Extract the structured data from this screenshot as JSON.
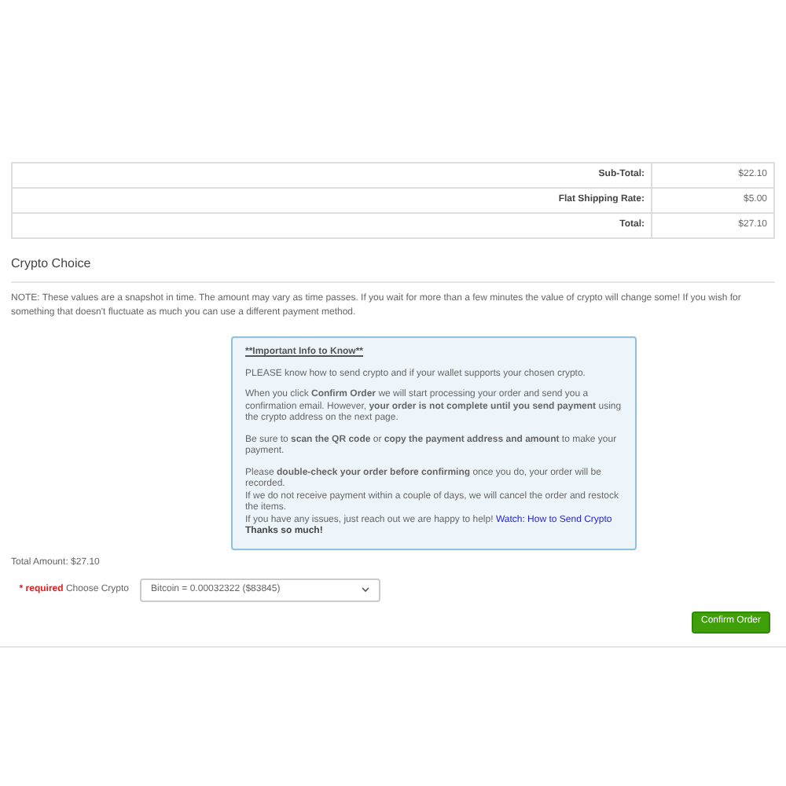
{
  "totals": [
    {
      "label": "Sub-Total:",
      "value": "$22.10"
    },
    {
      "label": "Flat Shipping Rate:",
      "value": "$5.00"
    },
    {
      "label": "Total:",
      "value": "$27.10"
    }
  ],
  "section_title": "Crypto Choice",
  "note": "NOTE: These values are a snapshot in time. The amount may vary as time passes. If you wait for more than a few minutes the value of crypto will change some! If you wish for something that doesn't fluctuate as much you can use a different payment method.",
  "info_box": {
    "title": "**Important Info to Know**",
    "paragraphs": [
      [
        {
          "text": "PLEASE know how to send crypto and if your wallet supports your chosen crypto."
        }
      ],
      [
        {
          "text": "When you click **Confirm Order** we will start processing your order and send you a confirmation email. However, **your order is not complete until you send payment** using the crypto address on the next page."
        }
      ],
      [
        {
          "text": "Be sure to **scan the QR code** or **copy the payment address and amount** to make your payment."
        }
      ],
      [
        {
          "text": "Please **double-check your order before confirming** once you do, your order will be recorded."
        },
        {
          "text": "If we do not receive payment within a couple of days, we will cancel the order and restock the items."
        },
        {
          "text": "If you have any issues, just reach out we are happy to help!",
          "link": "Watch: How to Send Crypto"
        },
        {
          "text": "Thanks so much!",
          "bold": true
        }
      ]
    ]
  },
  "total_amount": "Total Amount: $27.10",
  "crypto_field": {
    "required": "* required",
    "label": "Choose Crypto",
    "value": "Bitcoin = 0.00032322 ($83845)"
  },
  "confirm_button": "Confirm Order"
}
